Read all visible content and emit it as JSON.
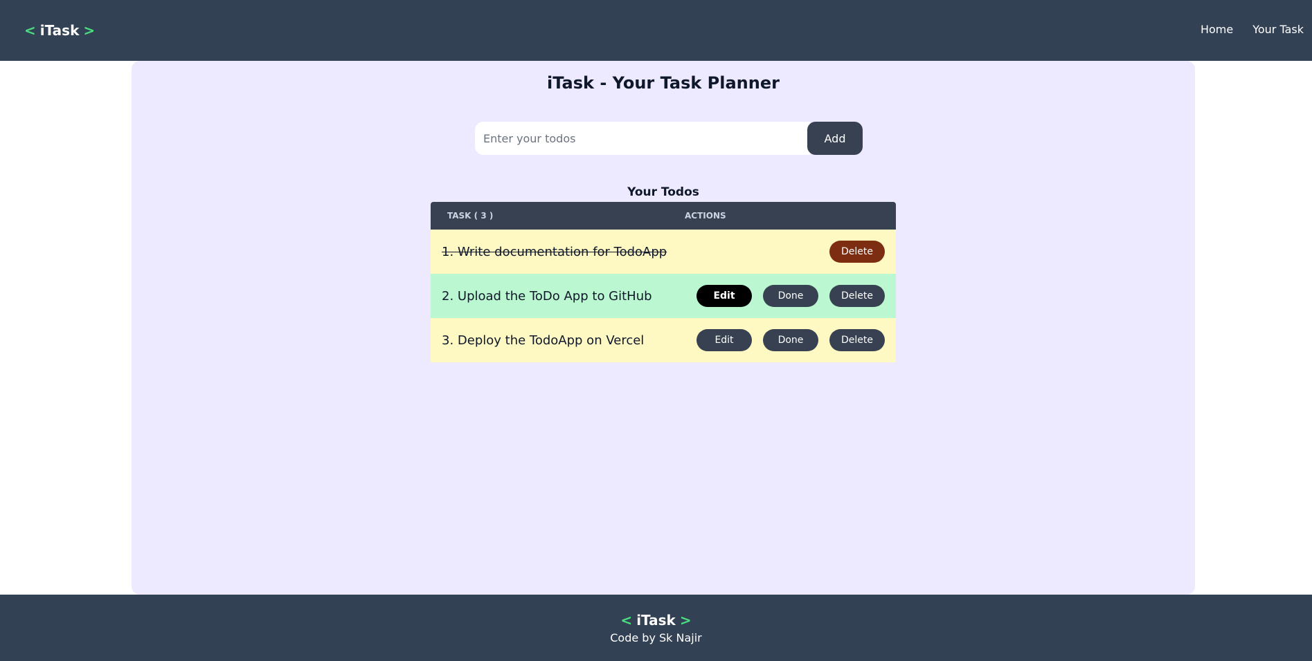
{
  "navbar": {
    "logo_open": "<",
    "logo_text": "iTask",
    "logo_close": ">",
    "links": [
      "Home",
      "Your Task"
    ]
  },
  "main": {
    "title": "iTask - Your Task Planner",
    "input_placeholder": "Enter your todos",
    "input_value": "",
    "add_label": "Add",
    "todos_title": "Your Todos",
    "table": {
      "col_task": "TASK ( 3 )",
      "col_actions": "ACTIONS",
      "rows": [
        {
          "text": "1. Write documentation for TodoApp",
          "completed": true,
          "actions": [
            "Delete"
          ]
        },
        {
          "text": "2. Upload the ToDo App to GitHub",
          "completed": false,
          "actions": [
            "Edit",
            "Done",
            "Delete"
          ]
        },
        {
          "text": "3. Deploy the TodoApp on Vercel",
          "completed": false,
          "actions": [
            "Edit",
            "Done",
            "Delete"
          ]
        }
      ]
    }
  },
  "footer": {
    "logo_open": "<",
    "logo_text": "iTask",
    "logo_close": ">",
    "credit": "Code by Sk Najir"
  },
  "colors": {
    "nav_bg": "#334155",
    "accent": "#4ade80",
    "card_bg": "#ede9fe",
    "row_yellow": "#fef9c3",
    "row_green": "#bbf7d0",
    "button_dark": "#374151",
    "delete_done": "#7c2d12"
  }
}
